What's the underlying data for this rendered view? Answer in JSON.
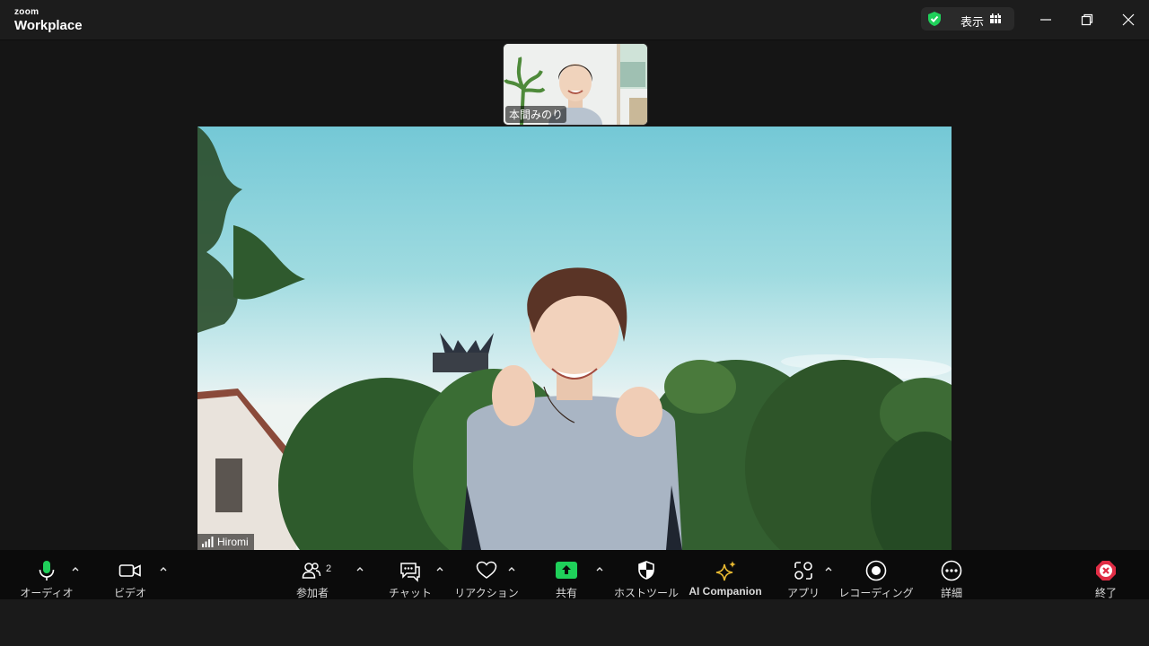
{
  "app": {
    "brand_small": "zoom",
    "brand_big": "Workplace"
  },
  "header": {
    "view_label": "表示"
  },
  "participants": {
    "thumbnail_name": "本間みのり",
    "main_name": "Hiromi"
  },
  "toolbar": {
    "audio": "オーディオ",
    "video": "ビデオ",
    "participants": "参加者",
    "participants_count": "2",
    "chat": "チャット",
    "reactions": "リアクション",
    "share": "共有",
    "host_tools": "ホストツール",
    "ai_companion": "AI Companion",
    "apps": "アプリ",
    "recording": "レコーディング",
    "more": "詳細",
    "end": "終了"
  },
  "colors": {
    "accent_green": "#1fd05a",
    "ai_gold": "#e8b931",
    "end_red": "#e02d45"
  }
}
